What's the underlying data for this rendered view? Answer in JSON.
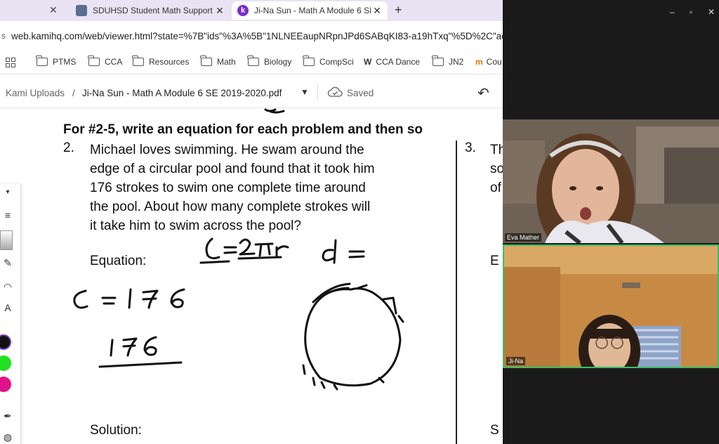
{
  "browser": {
    "tabs": [
      {
        "title": "SDUHSD Student Math Support"
      },
      {
        "title": "Ji-Na Sun - Math A Module 6 SE",
        "favicon": "k"
      }
    ],
    "new_tab_label": "+",
    "url": "web.kamihq.com/web/viewer.html?state=%7B\"ids\"%3A%5B\"1NLNEEaupNRpnJPd6SABqKI83-a19hTxq\"%5D%2C\"acti",
    "bookmarks": [
      "PTMS",
      "CCA",
      "Resources",
      "Math",
      "Biology",
      "CompSci",
      "CCA Dance",
      "JN2",
      "Cou"
    ]
  },
  "kami": {
    "breadcrumb_root": "Kami Uploads",
    "separator": "/",
    "document_name": "Ji-Na Sun - Math A Module 6 SE 2019-2020.pdf",
    "save_status": "Saved"
  },
  "document": {
    "heading": "For #2-5, write an equation for each problem and then so",
    "question_number": "2.",
    "question_lines": [
      "Michael loves swimming.  He swam around the",
      "edge of a circular pool and found that it took him",
      "176 strokes to swim one complete time around",
      "the pool.  About how many complete strokes will",
      "it take him to swim across the pool?"
    ],
    "equation_label": "Equation:",
    "solution_label": "Solution:",
    "next_question_number": "3.",
    "next_question_lines": [
      "Th",
      "so",
      "of"
    ],
    "next_equation_label": "E",
    "next_solution_label": "S"
  },
  "video": {
    "participants": [
      {
        "name": "Eva Mather"
      },
      {
        "name": "Ji-Na"
      }
    ],
    "active_speaker_color": "#39c060"
  }
}
